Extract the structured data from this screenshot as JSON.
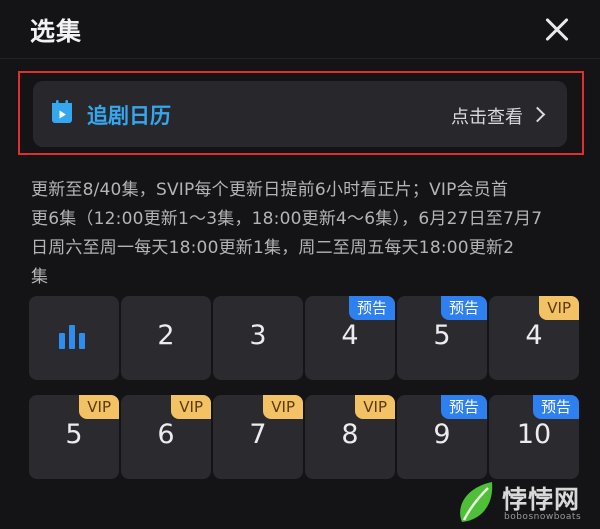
{
  "header": {
    "title": "选集",
    "close_icon": "close-icon"
  },
  "calendar_card": {
    "icon": "calendar-icon",
    "label": "追剧日历",
    "link_text": "点击查看",
    "accent_color": "#35a7ee",
    "highlight_color": "#e02f2f"
  },
  "description": {
    "lines": [
      "更新至8/40集，SVIP每个更新日提前6小时看正片；VIP会员首",
      "更6集（12:00更新1～3集，18:00更新4～6集），6月27日至7月7",
      "日周六至周一每天18:00更新1集，周二至周五每天18:00更新2",
      "集"
    ]
  },
  "episodes": [
    {
      "label": "",
      "icon": "now-playing-bars-icon",
      "badge": ""
    },
    {
      "label": "2",
      "badge": ""
    },
    {
      "label": "3",
      "badge": ""
    },
    {
      "label": "4",
      "badge": "预告",
      "badge_type": "preview"
    },
    {
      "label": "5",
      "badge": "预告",
      "badge_type": "preview"
    },
    {
      "label": "4",
      "badge": "VIP",
      "badge_type": "vip"
    },
    {
      "label": "5",
      "badge": "VIP",
      "badge_type": "vip"
    },
    {
      "label": "6",
      "badge": "VIP",
      "badge_type": "vip"
    },
    {
      "label": "7",
      "badge": "VIP",
      "badge_type": "vip"
    },
    {
      "label": "8",
      "badge": "VIP",
      "badge_type": "vip"
    },
    {
      "label": "9",
      "badge": "预告",
      "badge_type": "preview"
    },
    {
      "label": "10",
      "badge": "预告",
      "badge_type": "preview"
    }
  ],
  "colors": {
    "background": "#141416",
    "tile": "#2b2b2f",
    "preview_badge": "#2e7ff0",
    "vip_badge": "#f3c265"
  },
  "watermark": {
    "text": "悖悖网",
    "subtext": "bobosnowboats",
    "icon": "leaf-logo-icon"
  }
}
